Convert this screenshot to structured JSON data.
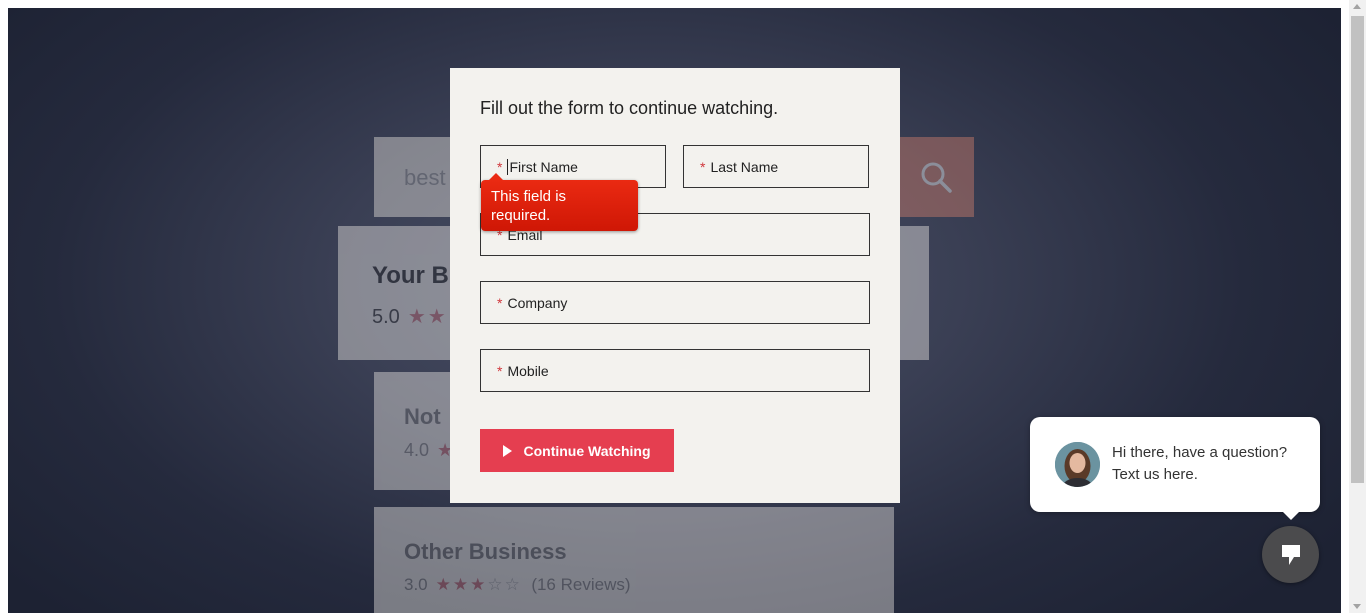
{
  "background": {
    "search_text": "best",
    "card1": {
      "title": "Your B",
      "rating": "5.0"
    },
    "card2": {
      "title": "Not",
      "rating": "4.0"
    },
    "card3": {
      "title": "Other Business",
      "rating": "3.0",
      "reviews": "(16 Reviews)"
    }
  },
  "form": {
    "heading": "Fill out the form to continue watching.",
    "required_marker": "*",
    "fields": {
      "first_name": "First Name",
      "last_name": "Last Name",
      "email": "Email",
      "company": "Company",
      "mobile": "Mobile"
    },
    "error_message": "This field is required.",
    "submit_label": "Continue Watching"
  },
  "chat": {
    "message": "Hi there, have a question? Text us here."
  },
  "icons": {
    "search": "search-icon",
    "play": "play-icon",
    "chat": "chat-icon",
    "avatar": "avatar"
  },
  "colors": {
    "accent": "#e53e50",
    "error": "#e21b08",
    "modal_bg": "#f3f2ee",
    "chat_button": "#4b4b4d"
  }
}
